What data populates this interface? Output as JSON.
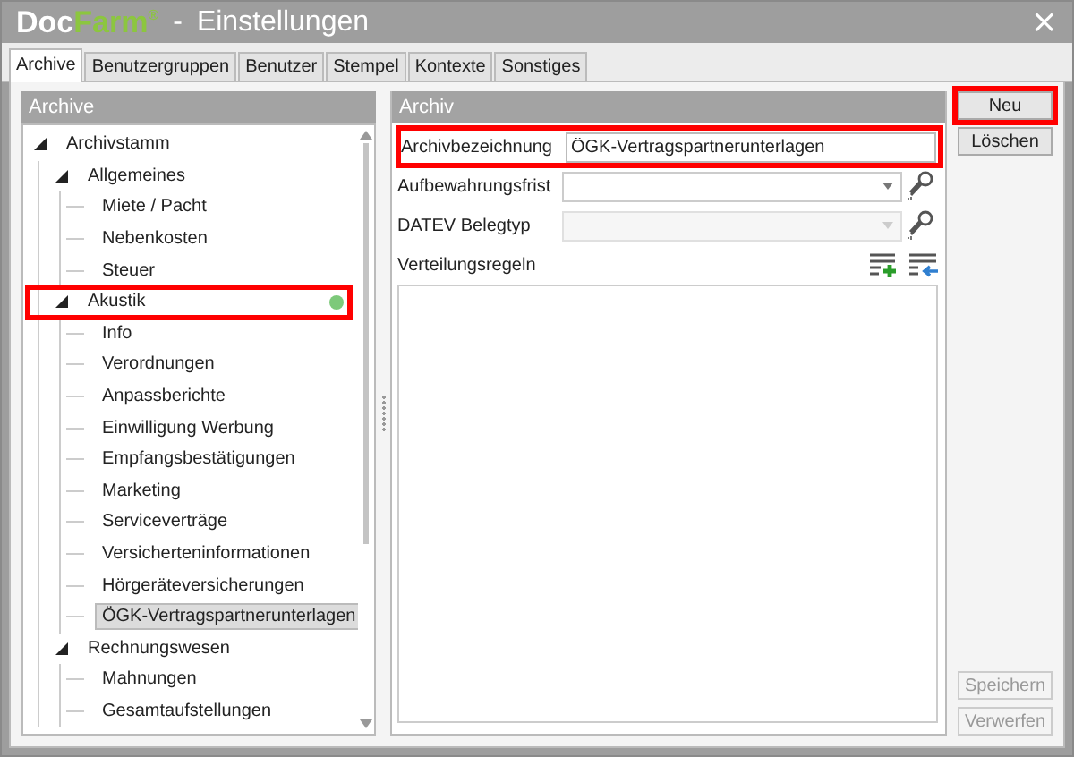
{
  "window": {
    "logo": [
      {
        "text": "Doc",
        "color": "#ffffff"
      },
      {
        "text": "Farm$^{®}$",
        "color": "#8cc63f"
      }
    ],
    "separator": "-",
    "title": "Einstellungen",
    "close": "×"
  },
  "tabs": [
    {
      "label": "Archive",
      "selected": true
    },
    {
      "label": "Benutzergruppen",
      "selected": false
    },
    {
      "label": "Benutzer",
      "selected": false
    },
    {
      "label": "Stempel",
      "selected": false
    },
    {
      "label": "Kontexte",
      "selected": false
    },
    {
      "label": "Sonstiges",
      "selected": false
    }
  ],
  "tree_panel": {
    "title": "Archive",
    "items": [
      {
        "label": "Archivstamm",
        "expanded": true,
        "selected": false,
        "highlighted": false,
        "children": [
          {
            "label": "Allgemeines",
            "expanded": true,
            "selected": false,
            "highlighted": false,
            "children": [
              {
                "label": "Miete / Pacht",
                "selected": false,
                "highlighted": false
              },
              {
                "label": "Nebenkosten",
                "selected": false,
                "highlighted": false
              },
              {
                "label": "Steuer",
                "selected": false,
                "highlighted": false
              }
            ]
          },
          {
            "label": "Akustik",
            "expanded": true,
            "selected": false,
            "highlighted": true,
            "color": "#7dc97a",
            "children": [
              {
                "label": "Info",
                "selected": false,
                "highlighted": false
              },
              {
                "label": "Verordnungen",
                "selected": false,
                "highlighted": false
              },
              {
                "label": "Anpassberichte",
                "selected": false,
                "highlighted": false
              },
              {
                "label": "Einwilligung Werbung",
                "selected": false,
                "highlighted": false
              },
              {
                "label": "Empfangsbestätigungen",
                "selected": false,
                "highlighted": false
              },
              {
                "label": "Marketing",
                "selected": false,
                "highlighted": false
              },
              {
                "label": "Serviceverträge",
                "selected": false,
                "highlighted": false
              },
              {
                "label": "Versicherteninformationen",
                "selected": false,
                "highlighted": false
              },
              {
                "label": "Hörgeräteversicherungen",
                "selected": false,
                "highlighted": false
              },
              {
                "label": "ÖGK-Vertragspartnerunterlagen",
                "selected": true,
                "highlighted": false
              }
            ]
          },
          {
            "label": "Rechnungswesen",
            "expanded": true,
            "selected": false,
            "highlighted": false,
            "children": [
              {
                "label": "Mahnungen",
                "selected": false,
                "highlighted": false
              },
              {
                "label": "Gesamtaufstellungen",
                "selected": false,
                "highlighted": false
              }
            ]
          }
        ]
      }
    ]
  },
  "detail_panel": {
    "title": "Archiv",
    "fields": [
      {
        "kind": "text",
        "label": "Archivbezeichnung",
        "value": "ÖGK-Vertragspartnerunterlagen",
        "highlighted": true
      },
      {
        "kind": "dropdown",
        "label": "Aufbewahrungsfrist",
        "disabled": false,
        "highlighted": false
      },
      {
        "kind": "dropdown",
        "label": "DATEV Belegtyp",
        "disabled": true,
        "highlighted": false
      }
    ],
    "rules_label": "Verteilungsregeln"
  },
  "buttons": [
    {
      "label": "Neu",
      "disabled": false,
      "highlighted": true
    },
    {
      "label": "Löschen",
      "disabled": false,
      "highlighted": false
    },
    {
      "label": "Speichern",
      "disabled": true,
      "highlighted": false
    },
    {
      "label": "Verwerfen",
      "disabled": true,
      "highlighted": false
    }
  ]
}
